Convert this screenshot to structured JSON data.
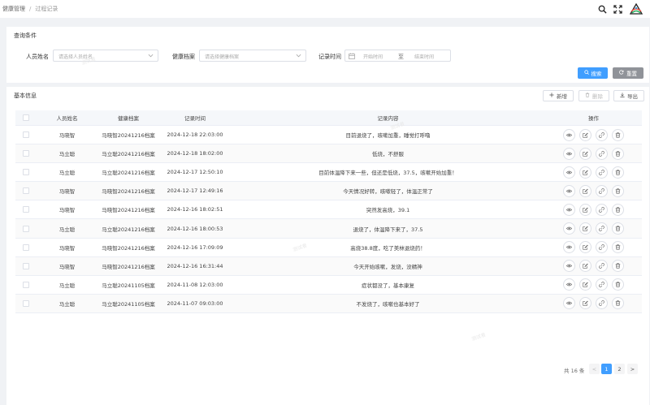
{
  "breadcrumb": {
    "parent": "健康管理",
    "separator": "/",
    "current": "过程记录"
  },
  "top_icons": [
    "search-icon",
    "fullscreen-icon",
    "logo-icon"
  ],
  "query": {
    "title": "查询条件",
    "person_label": "人员姓名",
    "person_placeholder": "请选择人员姓名",
    "archive_label": "健康档案",
    "archive_placeholder": "请选择健康档案",
    "time_label": "记录时间",
    "start_placeholder": "开始时间",
    "range_to": "至",
    "end_placeholder": "结束时间",
    "search_label": "搜索",
    "reset_label": "重置"
  },
  "table": {
    "title": "基本信息",
    "add_label": "新增",
    "delete_label": "删除",
    "export_label": "导出",
    "columns": [
      "人员姓名",
      "健康档案",
      "记录时间",
      "记录内容",
      "操作"
    ],
    "rows": [
      {
        "name": "马晓智",
        "archive": "马晓智20241216档案",
        "time": "2024-12-18 22:03:00",
        "content": "目前退烧了，咳嗽加重，睡觉打呼噜"
      },
      {
        "name": "马立聪",
        "archive": "马立聪20241216档案",
        "time": "2024-12-18 18:02:00",
        "content": "低烧，不舒服"
      },
      {
        "name": "马立聪",
        "archive": "马立聪20241216档案",
        "time": "2024-12-17 12:50:10",
        "content": "目前体温降下来一些，但还是低烧，37.5，咳嗽开始加重！"
      },
      {
        "name": "马晓智",
        "archive": "马晓智20241216档案",
        "time": "2024-12-17 12:49:16",
        "content": "今天情况好转，咳嗽轻了，体温正常了"
      },
      {
        "name": "马晓智",
        "archive": "马晓智20241216档案",
        "time": "2024-12-16 18:02:51",
        "content": "突然发高烧，39.1"
      },
      {
        "name": "马立聪",
        "archive": "马立聪20241216档案",
        "time": "2024-12-16 18:00:53",
        "content": "退烧了，体温降下来了，37.5"
      },
      {
        "name": "马晓智",
        "archive": "马晓智20241216档案",
        "time": "2024-12-16 17:09:09",
        "content": "高烧38.8度，吃了美林退烧药！"
      },
      {
        "name": "马晓智",
        "archive": "马晓智20241216档案",
        "time": "2024-12-16 16:31:44",
        "content": "今天开始咳嗽，发烧，没精神"
      },
      {
        "name": "马立聪",
        "archive": "马立聪20241105档案",
        "time": "2024-11-08 12:03:00",
        "content": "症状都没了，基本康复"
      },
      {
        "name": "马立聪",
        "archive": "马立聪20241105档案",
        "time": "2024-11-07 09:03:00",
        "content": "不发烧了，咳嗽也基本好了"
      }
    ],
    "row_actions": [
      "view-icon",
      "edit-icon",
      "link-icon",
      "delete-icon"
    ]
  },
  "pagination": {
    "total_text": "共 16 条",
    "prev": "<",
    "pages": [
      "1",
      "2"
    ],
    "current": "1",
    "next": ">"
  },
  "watermark": "测试者",
  "colors": {
    "primary": "#409eff",
    "reset": "#909399",
    "background": "#f0f2f5"
  }
}
